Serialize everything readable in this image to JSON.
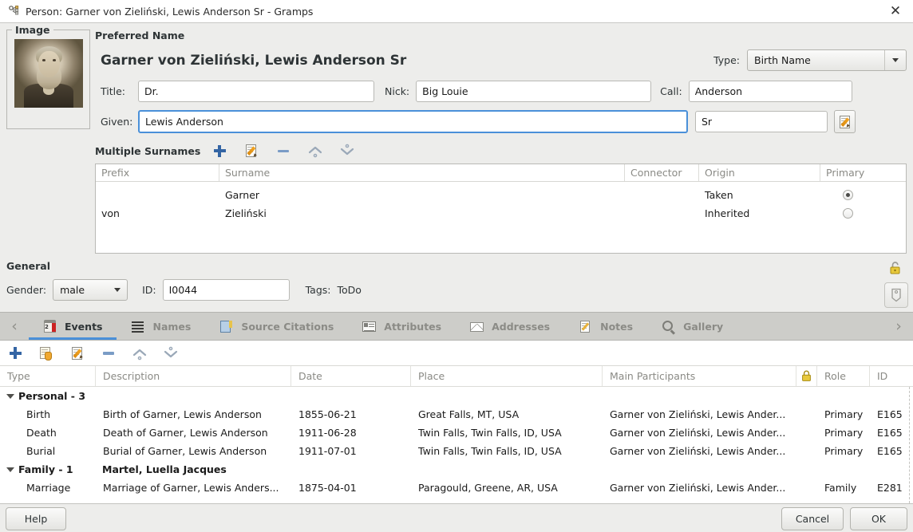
{
  "window": {
    "title": "Person: Garner von Zieliński, Lewis Anderson Sr - Gramps",
    "icon": "person-icon",
    "close_label": "✕"
  },
  "image_panel": {
    "legend": "Image",
    "photo_alt": "portrait-photograph"
  },
  "preferred_name": {
    "section_label": "Preferred Name",
    "display_name": "Garner von Zieliński, Lewis Anderson Sr",
    "title_label": "Title:",
    "title_value": "Dr.",
    "nick_label": "Nick:",
    "nick_value": "Big Louie",
    "call_label": "Call:",
    "call_value": "Anderson",
    "given_label": "Given:",
    "given_value": "Lewis Anderson",
    "suffix_value": "Sr",
    "type_label": "Type:",
    "type_value": "Birth Name",
    "edit_button_icon": "edit-name-icon"
  },
  "surnames": {
    "section_label": "Multiple Surnames",
    "toolbar": [
      {
        "name": "add-surname-button",
        "icon": "plus-icon"
      },
      {
        "name": "edit-surname-button",
        "icon": "edit-icon"
      },
      {
        "name": "remove-surname-button",
        "icon": "minus-icon"
      },
      {
        "name": "move-up-surname-button",
        "icon": "chevron-up-icon"
      },
      {
        "name": "move-down-surname-button",
        "icon": "chevron-down-icon"
      }
    ],
    "columns": [
      "Prefix",
      "Surname",
      "Connector",
      "Origin",
      "Primary"
    ],
    "rows": [
      {
        "prefix": "",
        "surname": "Garner",
        "connector": "",
        "origin": "Taken",
        "primary": true
      },
      {
        "prefix": "von",
        "surname": "Zieliński",
        "connector": "",
        "origin": "Inherited",
        "primary": false
      }
    ]
  },
  "general": {
    "section_label": "General",
    "gender_label": "Gender:",
    "gender_value": "male",
    "id_label": "ID:",
    "id_value": "I0044",
    "tags_label": "Tags:",
    "tags_value": "ToDo",
    "privacy_icon": "unlocked-padlock-icon",
    "tag_button_icon": "tag-icon"
  },
  "tabs": {
    "prev_arrow": "‹",
    "next_arrow": "›",
    "items": [
      {
        "label": "Events",
        "icon": "calendar-events-icon",
        "active": true
      },
      {
        "label": "Names",
        "icon": "list-names-icon",
        "active": false
      },
      {
        "label": "Source Citations",
        "icon": "book-source-icon",
        "active": false
      },
      {
        "label": "Attributes",
        "icon": "attributes-card-icon",
        "active": false
      },
      {
        "label": "Addresses",
        "icon": "envelope-icon",
        "active": false
      },
      {
        "label": "Notes",
        "icon": "note-pencil-icon",
        "active": false
      },
      {
        "label": "Gallery",
        "icon": "magnifier-gallery-icon",
        "active": false
      }
    ]
  },
  "events": {
    "toolbar": [
      {
        "name": "add-event-button",
        "icon": "plus-icon"
      },
      {
        "name": "share-event-button",
        "icon": "share-hand-icon"
      },
      {
        "name": "edit-event-button",
        "icon": "edit-icon"
      },
      {
        "name": "remove-event-button",
        "icon": "minus-icon"
      },
      {
        "name": "move-up-event-button",
        "icon": "chevron-up-icon"
      },
      {
        "name": "move-down-event-button",
        "icon": "chevron-down-icon"
      }
    ],
    "columns": [
      "Type",
      "Description",
      "Date",
      "Place",
      "Main Participants",
      "",
      "Role",
      "ID"
    ],
    "lock_column_icon": "padlock-icon",
    "groups": [
      {
        "label": "Personal - 3",
        "sublabel": "",
        "rows": [
          {
            "type": "Birth",
            "description": "Birth of Garner, Lewis Anderson",
            "date": "1855-06-21",
            "place": "Great Falls, MT, USA",
            "participants": "Garner von Zieliński, Lewis Ander...",
            "role": "Primary",
            "id": "E165"
          },
          {
            "type": "Death",
            "description": "Death of Garner, Lewis Anderson",
            "date": "1911-06-28",
            "place": "Twin Falls, Twin Falls, ID, USA",
            "participants": "Garner von Zieliński, Lewis Ander...",
            "role": "Primary",
            "id": "E165"
          },
          {
            "type": "Burial",
            "description": "Burial of Garner, Lewis Anderson",
            "date": "1911-07-01",
            "place": "Twin Falls, Twin Falls, ID, USA",
            "participants": "Garner von Zieliński, Lewis Ander...",
            "role": "Primary",
            "id": "E165"
          }
        ]
      },
      {
        "label": "Family - 1",
        "sublabel": "Martel, Luella Jacques",
        "rows": [
          {
            "type": "Marriage",
            "description": "Marriage of Garner, Lewis Anders...",
            "date": "1875-04-01",
            "place": "Paragould, Greene, AR, USA",
            "participants": "Garner von Zieliński, Lewis Ander...",
            "role": "Family",
            "id": "E281"
          }
        ]
      }
    ]
  },
  "footer": {
    "help_label": "Help",
    "cancel_label": "Cancel",
    "ok_label": "OK"
  }
}
